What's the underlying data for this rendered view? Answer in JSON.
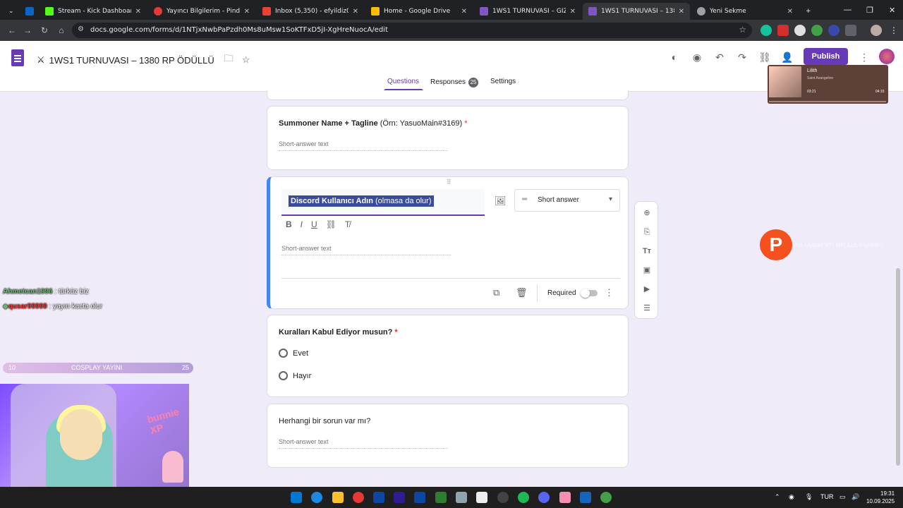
{
  "browser": {
    "tabs": [
      {
        "title": "Stream - Kick Dashboard",
        "favicon_color": "#53fc18"
      },
      {
        "title": "Yayıncı Bilgilerim - Pindirim",
        "favicon_color": "#e53935"
      },
      {
        "title": "Inbox (5,350) - efyildiz0@gm",
        "favicon_color": "#ea4335"
      },
      {
        "title": "Home - Google Drive",
        "favicon_color": "#fbbc04"
      },
      {
        "title": "1WS1 TURNUVASI – GİZE",
        "favicon_color": "#7e57c2"
      },
      {
        "title": "1WS1 TURNUVASI – 1380",
        "favicon_color": "#7e57c2"
      },
      {
        "title": "Yeni Sekme",
        "favicon_color": "#9aa0a6"
      }
    ],
    "url": "docs.google.com/forms/d/1NTjxNwbPaPzdh0Ms8uMsw1SoKTFxD5jI-XgHreNuocA/edit"
  },
  "form_header": {
    "title": "1WS1 TURNUVASI – 1380 RP ÖDÜLLÜ",
    "publish_label": "Publish",
    "tabs": {
      "questions": "Questions",
      "responses": "Responses",
      "responses_count": "25",
      "settings": "Settings"
    }
  },
  "music_widget": {
    "song": "Lilith",
    "artist": "Saint Avangeline",
    "elapsed": "03:21",
    "duration": "04:15"
  },
  "questions": [
    {
      "title_main": "Summoner Name + Tagline",
      "title_hint": "(Örn: YasuoMain#3169)",
      "required": "*",
      "placeholder": "Short-answer text"
    },
    {
      "title_bold": "Discord Kullanıcı Adın",
      "title_hint": "(olmasa da olur)",
      "type": "Short answer",
      "placeholder": "Short-answer text",
      "required_label": "Required"
    },
    {
      "title": "Kuralları Kabul Ediyor musun?",
      "required": "*",
      "options": [
        "Evet",
        "Hayır"
      ]
    },
    {
      "title": "Herhangi bir sorun var mı?",
      "placeholder": "Short-answer text"
    }
  ],
  "stream_overlay": {
    "chat": [
      {
        "user": "Ahmetcan1996",
        "message": "türküz biz",
        "user_color": "#66bb6a"
      },
      {
        "user": "qusar99999",
        "message": "yayın kacta olur",
        "user_color": "#e53935"
      }
    ],
    "goal_left": "10",
    "goal_label": "COSPLAY YAYINI",
    "goal_right": "25",
    "webcam_neon": "bunnie XP",
    "pbubble_letter": "P",
    "ptext": "En Uygun VP, RP, LoL Fiyatları!"
  },
  "taskbar": {
    "lang": "TUR",
    "time": "19:31",
    "date": "10.09.2025"
  }
}
